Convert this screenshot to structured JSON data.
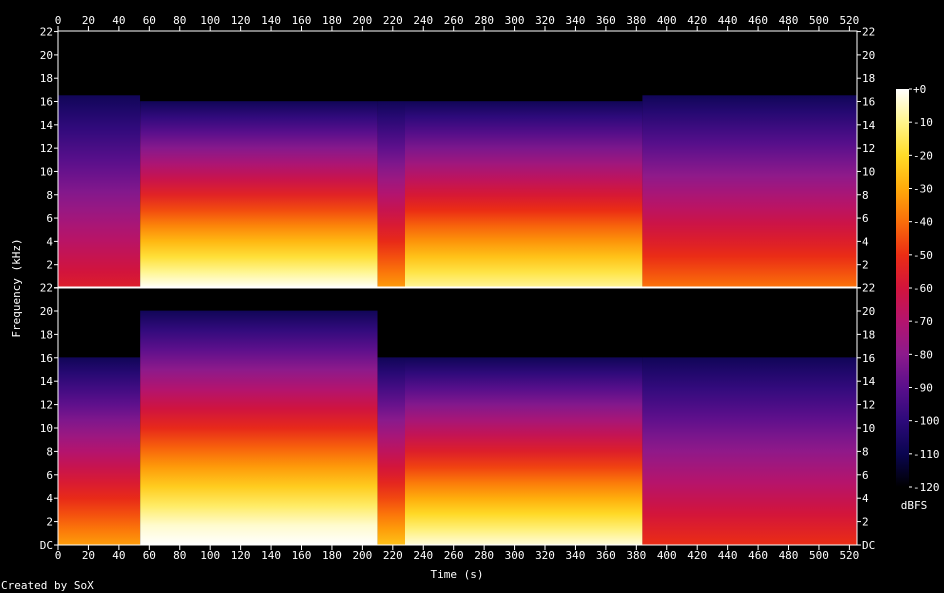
{
  "chart_data": {
    "type": "heatmap",
    "xlabel": "Time (s)",
    "ylabel": "Frequency (kHz)",
    "credit": "Created by SoX",
    "xlim": [
      0,
      525
    ],
    "ylim_khz": [
      0,
      22.05
    ],
    "x_ticks": [
      0,
      20,
      40,
      60,
      80,
      100,
      120,
      140,
      160,
      180,
      200,
      220,
      240,
      260,
      280,
      300,
      320,
      340,
      360,
      380,
      400,
      420,
      440,
      460,
      480,
      500,
      520
    ],
    "top_channel_y_ticks": [
      "",
      "2",
      "4",
      "6",
      "8",
      "10",
      "12",
      "14",
      "16",
      "18",
      "20",
      "22"
    ],
    "bottom_channel_y_ticks": [
      "DC",
      "2",
      "4",
      "6",
      "8",
      "10",
      "12",
      "14",
      "16",
      "18",
      "20",
      "22"
    ],
    "colorbar": {
      "label": "dBFS",
      "range": [
        -120,
        0
      ],
      "ticks": [
        "+0",
        "-10",
        "-20",
        "-30",
        "-40",
        "-50",
        "-60",
        "-70",
        "-80",
        "-90",
        "-100",
        "-110",
        "-120"
      ],
      "stops": [
        "#000000",
        "#0a0550",
        "#2d0a7a",
        "#5a0f8c",
        "#8c1a8c",
        "#b4146e",
        "#d2143c",
        "#eb2d14",
        "#fa6e0a",
        "#ffaa0a",
        "#ffdc28",
        "#fff58c",
        "#ffffff"
      ]
    },
    "channels": [
      {
        "segments": [
          {
            "start": 0,
            "end": 54,
            "bandwidth_khz": 16.5,
            "intensity": 0.38
          },
          {
            "start": 54,
            "end": 210,
            "bandwidth_khz": 16,
            "intensity": 0.78
          },
          {
            "start": 210,
            "end": 228,
            "bandwidth_khz": 16,
            "intensity": 0.55
          },
          {
            "start": 228,
            "end": 384,
            "bandwidth_khz": 16,
            "intensity": 0.72
          },
          {
            "start": 384,
            "end": 525,
            "bandwidth_khz": 16.5,
            "intensity": 0.5
          }
        ]
      },
      {
        "segments": [
          {
            "start": 0,
            "end": 54,
            "bandwidth_khz": 16,
            "intensity": 0.55
          },
          {
            "start": 54,
            "end": 210,
            "bandwidth_khz": 20,
            "intensity": 0.82
          },
          {
            "start": 210,
            "end": 228,
            "bandwidth_khz": 16,
            "intensity": 0.6
          },
          {
            "start": 228,
            "end": 384,
            "bandwidth_khz": 16,
            "intensity": 0.76
          },
          {
            "start": 384,
            "end": 525,
            "bandwidth_khz": 16,
            "intensity": 0.42
          }
        ]
      }
    ]
  }
}
